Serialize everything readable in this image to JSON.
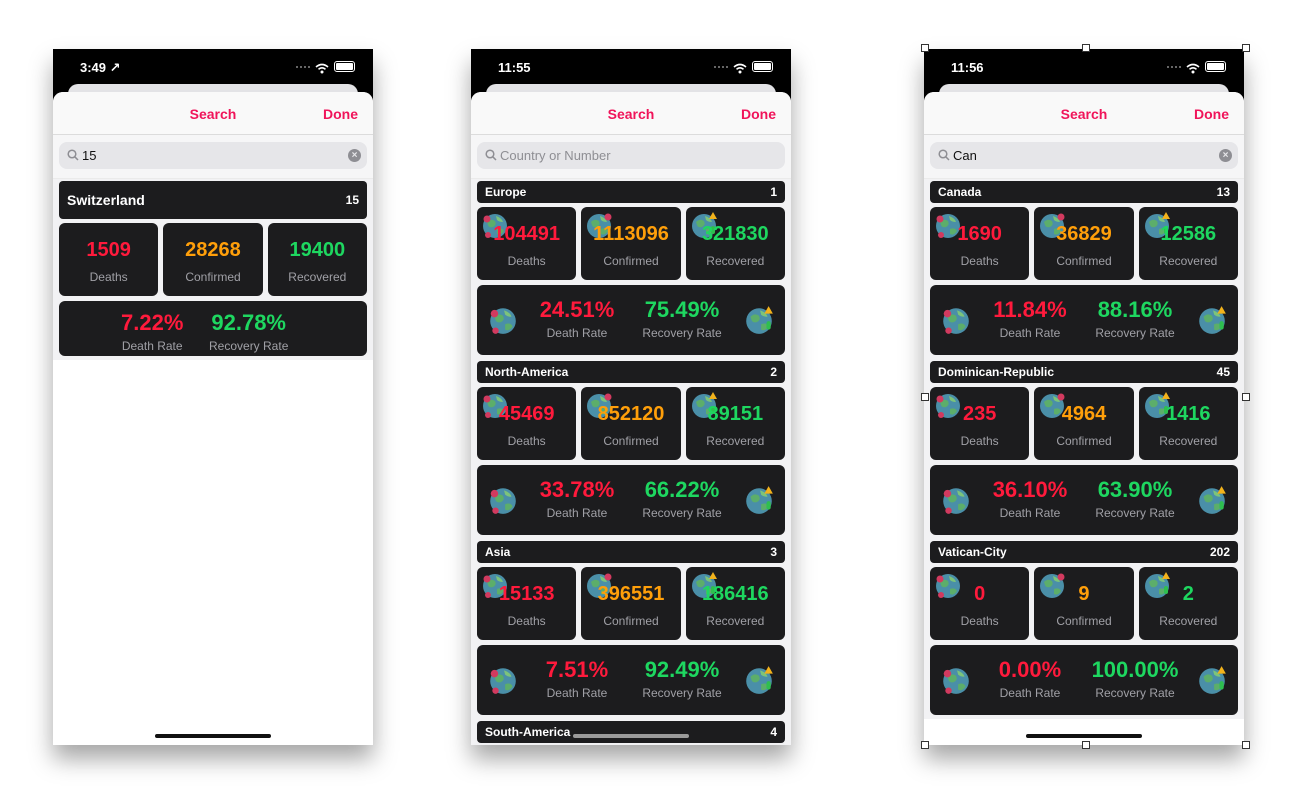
{
  "colors": {
    "accent": "#f0145a",
    "deaths": "#ff1a3c",
    "confirmed": "#ff9f0a",
    "recovered": "#1ed760",
    "card": "#1c1c1e"
  },
  "icons": {
    "search": "magnifier-icon",
    "clear": "clear-x-icon",
    "globe": "globe-virus-icon",
    "location": "location-arrow-icon",
    "wifi": "wifi-icon",
    "battery": "battery-icon"
  },
  "labels": {
    "deaths": "Deaths",
    "confirmed": "Confirmed",
    "recovered": "Recovered",
    "death_rate": "Death Rate",
    "recovery_rate": "Recovery Rate"
  },
  "screens": [
    {
      "time": "3:49 ↗",
      "nav_title": "Search",
      "done": "Done",
      "search_value": "15",
      "search_placeholder": "Country or Number",
      "sections": [
        {
          "name": "Switzerland",
          "num": "15",
          "deaths": "1509",
          "confirmed": "28268",
          "recovered": "19400",
          "death_rate": "7.22%",
          "recovery_rate": "92.78%"
        }
      ]
    },
    {
      "time": "11:55",
      "nav_title": "Search",
      "done": "Done",
      "search_value": "",
      "search_placeholder": "Country or Number",
      "sections": [
        {
          "name": "Europe",
          "num": "1",
          "deaths": "104491",
          "confirmed": "1113096",
          "recovered": "321830",
          "death_rate": "24.51%",
          "recovery_rate": "75.49%"
        },
        {
          "name": "North-America",
          "num": "2",
          "deaths": "45469",
          "confirmed": "852120",
          "recovered": "89151",
          "death_rate": "33.78%",
          "recovery_rate": "66.22%"
        },
        {
          "name": "Asia",
          "num": "3",
          "deaths": "15133",
          "confirmed": "396551",
          "recovered": "186416",
          "death_rate": "7.51%",
          "recovery_rate": "92.49%"
        },
        {
          "name": "South-America",
          "num": "4"
        }
      ]
    },
    {
      "time": "11:56",
      "nav_title": "Search",
      "done": "Done",
      "search_value": "Can",
      "search_placeholder": "Country or Number",
      "sections": [
        {
          "name": "Canada",
          "num": "13",
          "deaths": "1690",
          "confirmed": "36829",
          "recovered": "12586",
          "death_rate": "11.84%",
          "recovery_rate": "88.16%"
        },
        {
          "name": "Dominican-Republic",
          "num": "45",
          "deaths": "235",
          "confirmed": "4964",
          "recovered": "1416",
          "death_rate": "36.10%",
          "recovery_rate": "63.90%"
        },
        {
          "name": "Vatican-City",
          "num": "202",
          "deaths": "0",
          "confirmed": "9",
          "recovered": "2",
          "death_rate": "0.00%",
          "recovery_rate": "100.00%"
        }
      ]
    }
  ]
}
